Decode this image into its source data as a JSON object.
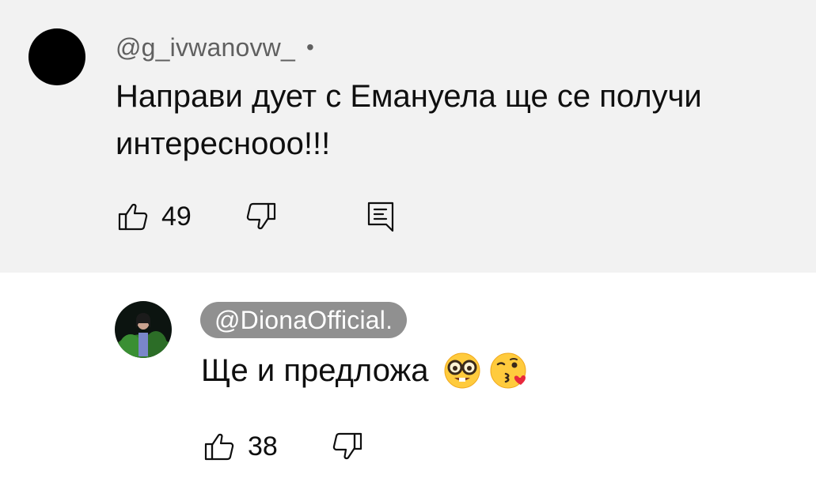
{
  "comment": {
    "author": "@g_ivwanovw_",
    "separator": "•",
    "text": "Направи дует с Емануела ще се получи интересноoo!!!",
    "likes": "49",
    "like_icon": "thumbs-up-icon",
    "dislike_icon": "thumbs-down-icon",
    "reply_icon": "reply-comment-icon",
    "avatar_color": "#000000"
  },
  "reply": {
    "author": "@DionaOfficial.",
    "text": "Ще и предложа",
    "emojis": [
      "nerd-face-emoji",
      "face-blowing-kiss-emoji"
    ],
    "likes": "38",
    "like_icon": "thumbs-up-icon",
    "dislike_icon": "thumbs-down-icon",
    "author_pill_color": "#909090"
  },
  "colors": {
    "top_background": "#f2f2f2",
    "reply_background": "#ffffff",
    "secondary_text": "#606060",
    "primary_text": "#0f0f0f"
  }
}
